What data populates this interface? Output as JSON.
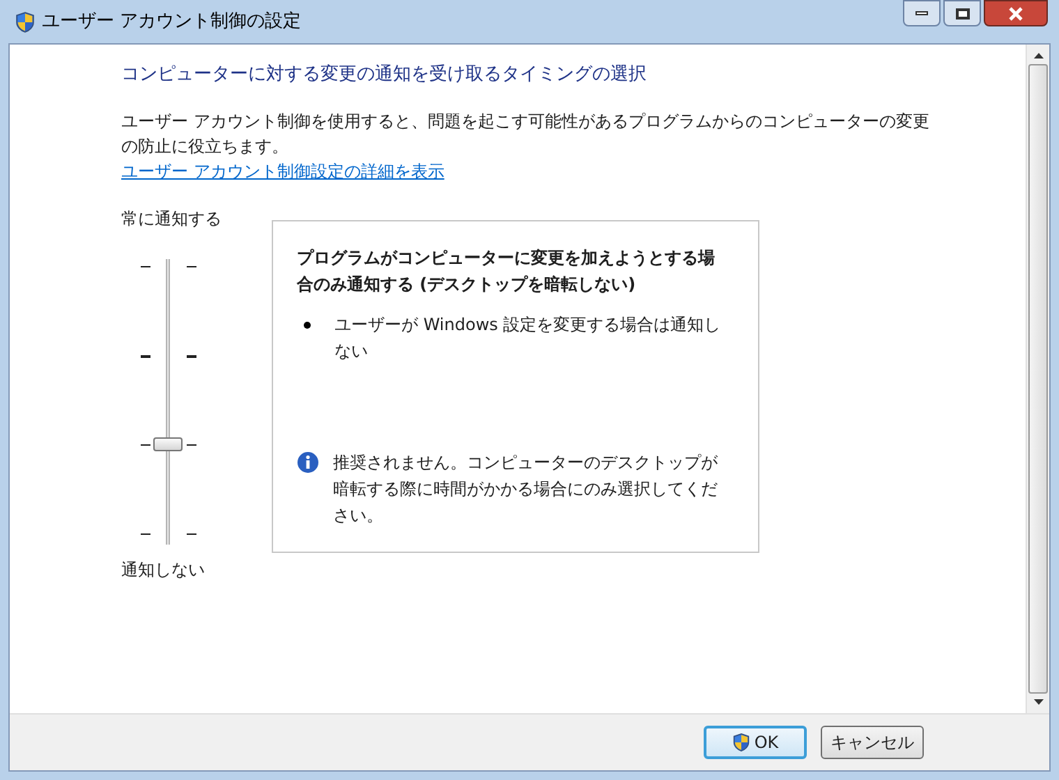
{
  "window": {
    "title": "ユーザー アカウント制御の設定"
  },
  "heading": "コンピューターに対する変更の通知を受け取るタイミングの選択",
  "description": "ユーザー アカウント制御を使用すると、問題を起こす可能性があるプログラムからのコンピューターの変更の防止に役立ちます。",
  "link": "ユーザー アカウント制御設定の詳細を表示",
  "slider": {
    "top_label": "常に通知する",
    "bottom_label": "通知しない",
    "level": 0.3333
  },
  "info_box": {
    "title": "プログラムがコンピューターに変更を加えようとする場合のみ通知する (デスクトップを暗転しない)",
    "bullets": [
      "ユーザーが Windows 設定を変更する場合は通知しない"
    ],
    "note": "推奨されません。コンピューターのデスクトップが暗転する際に時間がかかる場合にのみ選択してください。"
  },
  "buttons": [
    {
      "label": "OK",
      "shield": true,
      "default": true
    },
    {
      "label": "キャンセル",
      "shield": false,
      "default": false
    }
  ]
}
